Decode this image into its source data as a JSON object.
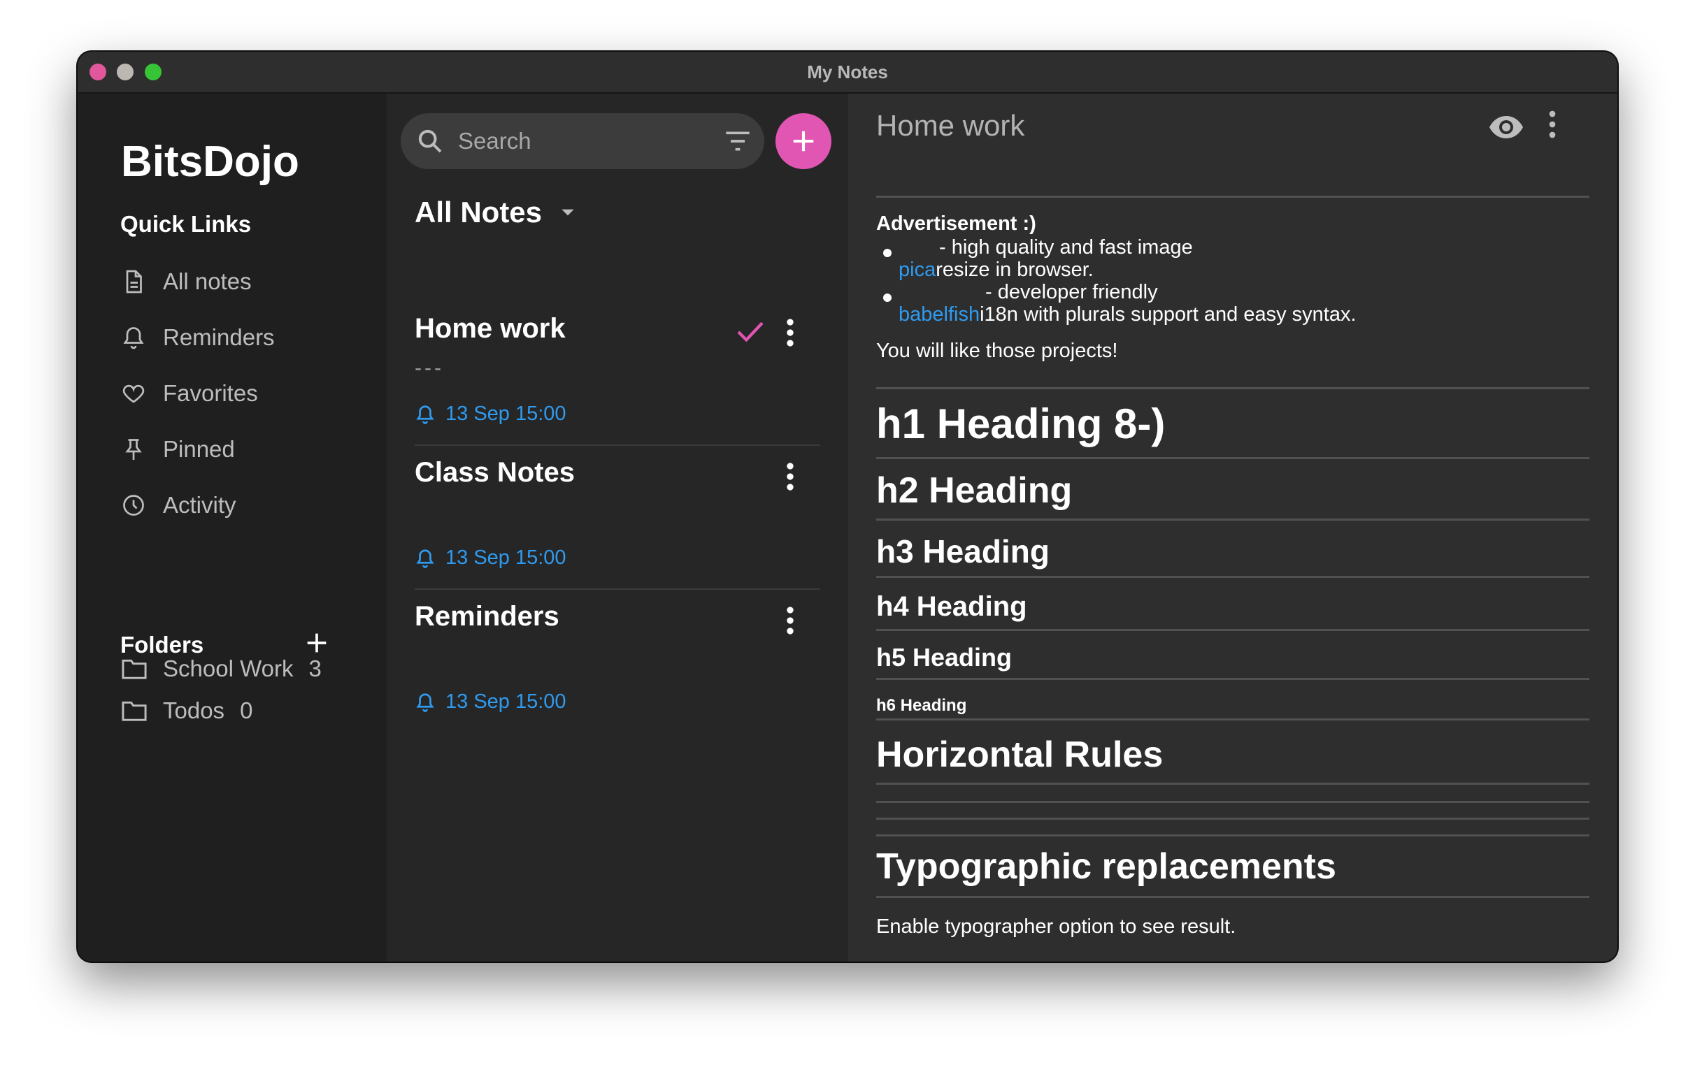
{
  "window": {
    "title": "My Notes"
  },
  "sidebar": {
    "brand": "BitsDojo",
    "quick_links_heading": "Quick Links",
    "quick_links": [
      {
        "label": "All notes",
        "icon": "document-icon"
      },
      {
        "label": "Reminders",
        "icon": "bell-icon"
      },
      {
        "label": "Favorites",
        "icon": "heart-icon"
      },
      {
        "label": "Pinned",
        "icon": "pin-icon"
      },
      {
        "label": "Activity",
        "icon": "clock-icon"
      }
    ],
    "folders_heading": "Folders",
    "folders": [
      {
        "label": "School Work",
        "count": "3"
      },
      {
        "label": "Todos",
        "count": "0"
      }
    ]
  },
  "note_list": {
    "search_placeholder": "Search",
    "title": "All Notes",
    "notes": [
      {
        "title": "Home work",
        "preview": "---",
        "date": "13 Sep 15:00"
      },
      {
        "title": "Class Notes",
        "preview": "",
        "date": "13 Sep 15:00"
      },
      {
        "title": "Reminders",
        "preview": "",
        "date": "13 Sep 15:00"
      }
    ]
  },
  "editor": {
    "title": "Home work",
    "advert_heading": "Advertisement :)",
    "bullets": [
      {
        "link": "pica",
        "line1": "- high quality and fast image",
        "line2": "resize in browser."
      },
      {
        "link": "babelfish",
        "line1": "- developer friendly",
        "line2": "i18n with plurals support and easy syntax."
      }
    ],
    "advert_footer": "You will like those projects!",
    "h1": "h1 Heading 8-)",
    "h2": "h2 Heading",
    "h3": "h3 Heading",
    "h4": "h4 Heading",
    "h5": "h5 Heading",
    "h6": "h6 Heading",
    "hr_heading": "Horizontal Rules",
    "typo_heading": "Typographic replacements",
    "typo_text": "Enable typographer option to see result."
  },
  "colors": {
    "accent": "#e256b3",
    "link": "#2f9bf0",
    "sidebar_bg": "#1f1f1f",
    "list_bg": "#262626",
    "editor_bg": "#2e2e2e"
  }
}
